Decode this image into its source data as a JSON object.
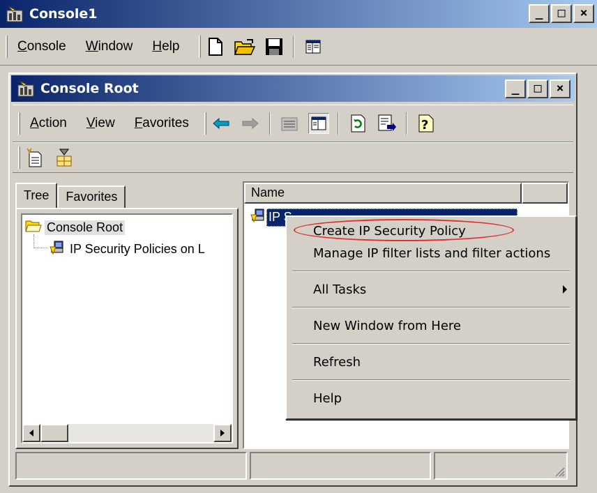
{
  "outer_window": {
    "title": "Console1",
    "menu": [
      "Console",
      "Window",
      "Help"
    ],
    "menu_access": [
      "C",
      "W",
      "H"
    ],
    "menu_rest": [
      "onsole",
      "indow",
      "elp"
    ],
    "caption_min": "_",
    "caption_max": "□",
    "caption_close": "×"
  },
  "inner_window": {
    "title": "Console Root",
    "menu_access": [
      "A",
      "V",
      "F"
    ],
    "menu_rest": [
      "ction",
      "iew",
      "avorites"
    ],
    "caption_min": "_",
    "caption_max": "□",
    "caption_close": "×"
  },
  "tree_pane": {
    "tabs": [
      "Tree",
      "Favorites"
    ],
    "nodes": [
      {
        "label": "Console Root",
        "icon": "folder-open-icon"
      },
      {
        "label": "IP Security Policies on L",
        "icon": "ip-security-icon"
      }
    ]
  },
  "list_pane": {
    "column_header": "Name",
    "selected_item": "IP S"
  },
  "context_menu": {
    "items": [
      {
        "label": "Create IP Security Policy",
        "highlighted": true
      },
      {
        "label": "Manage IP filter lists and filter actions"
      },
      {
        "label": "All Tasks",
        "submenu": true
      },
      {
        "label": "New Window from Here"
      },
      {
        "label": "Refresh"
      },
      {
        "label": "Help"
      }
    ],
    "highlight_color": "#e03030"
  },
  "colors": {
    "title_gradient_start": "#0a246a",
    "title_gradient_end": "#a6caf0",
    "face": "#d4d0c8",
    "selection": "#0a246a"
  }
}
